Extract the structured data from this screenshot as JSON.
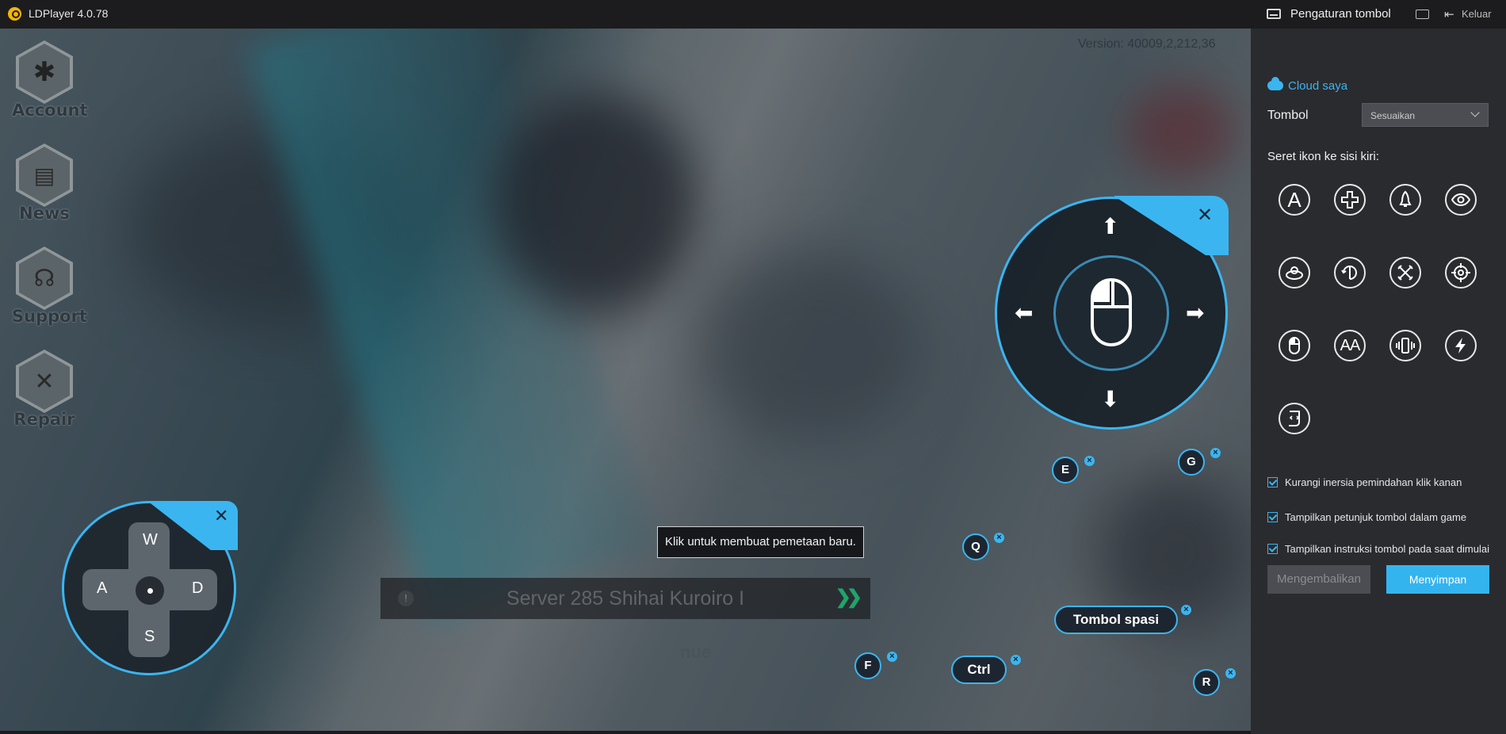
{
  "app": {
    "title": "LDPlayer 4.0.78"
  },
  "game": {
    "version": "Version: 40009,2,212,36",
    "sidebar": [
      {
        "label": "Account",
        "icon": "account-icon"
      },
      {
        "label": "News",
        "icon": "news-icon"
      },
      {
        "label": "Support",
        "icon": "headset-icon"
      },
      {
        "label": "Repair",
        "icon": "tools-icon"
      }
    ],
    "server": "Server 285 Shihai Kuroiro I",
    "continue": "Continue",
    "tooltip": "Klik untuk membuat pemetaan baru."
  },
  "mapping": {
    "wasd": {
      "up": "W",
      "left": "A",
      "right": "D",
      "down": "S"
    },
    "keys": [
      "E",
      "G",
      "Q",
      "F",
      "R"
    ],
    "pills": {
      "ctrl": "Ctrl",
      "space": "Tombol spasi"
    },
    "accent": "#3bb5f0"
  },
  "panel": {
    "title": "Pengaturan tombol",
    "exit": "Keluar",
    "cloud": "Cloud saya",
    "tombol_label": "Tombol",
    "tombol_value": "Sesuaikan",
    "drag_hint": "Seret ikon ke sisi kiri:",
    "tools": [
      "tap-key-icon",
      "dpad-icon",
      "rocket-skill-icon",
      "eye-view-icon",
      "rotate-pad-icon",
      "rotate-view-icon",
      "crossed-swords-icon",
      "crosshair-icon",
      "mouse-icon",
      "combo-key-icon",
      "shake-phone-icon",
      "lightning-icon",
      "script-icon"
    ],
    "tool_text": {
      "tap": "A",
      "combo": "AA"
    },
    "checks": [
      "Kurangi inersia pemindahan klik kanan",
      "Tampilkan petunjuk tombol dalam game",
      "Tampilkan instruksi tombol pada saat dimulai"
    ],
    "btn_reset": "Mengembalikan",
    "btn_save": "Menyimpan"
  }
}
